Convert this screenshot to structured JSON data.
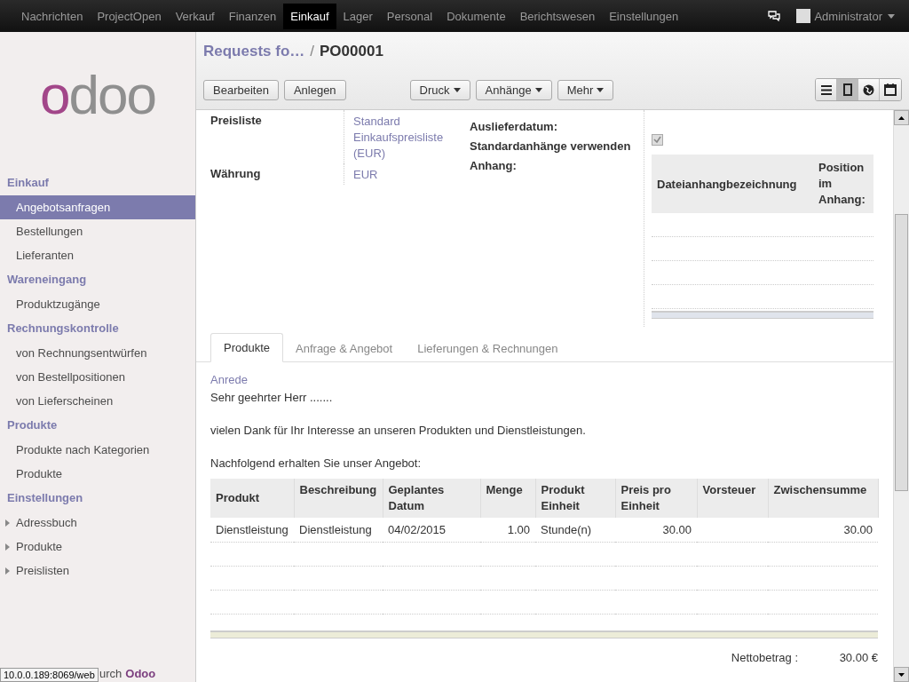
{
  "top_menu": [
    {
      "label": "Nachrichten",
      "selected": false
    },
    {
      "label": "ProjectOpen",
      "selected": false
    },
    {
      "label": "Verkauf",
      "selected": false
    },
    {
      "label": "Finanzen",
      "selected": false
    },
    {
      "label": "Einkauf",
      "selected": true
    },
    {
      "label": "Lager",
      "selected": false
    },
    {
      "label": "Personal",
      "selected": false
    },
    {
      "label": "Dokumente",
      "selected": false
    },
    {
      "label": "Berichtswesen",
      "selected": false
    },
    {
      "label": "Einstellungen",
      "selected": false
    }
  ],
  "user": {
    "name": "Administrator"
  },
  "logo": "odoo",
  "sidebar": [
    {
      "title": "Einkauf",
      "items": [
        {
          "label": "Angebotsanfragen",
          "selected": true,
          "kind": "link"
        },
        {
          "label": "Bestellungen",
          "selected": false,
          "kind": "link"
        },
        {
          "label": "Lieferanten",
          "selected": false,
          "kind": "link"
        }
      ]
    },
    {
      "title": "Wareneingang",
      "items": [
        {
          "label": "Produktzugänge",
          "selected": false,
          "kind": "link"
        }
      ]
    },
    {
      "title": "Rechnungskontrolle",
      "items": [
        {
          "label": "von Rechnungsentwürfen",
          "selected": false,
          "kind": "link"
        },
        {
          "label": "von Bestellpositionen",
          "selected": false,
          "kind": "link"
        },
        {
          "label": "von Lieferscheinen",
          "selected": false,
          "kind": "link"
        }
      ]
    },
    {
      "title": "Produkte",
      "items": [
        {
          "label": "Produkte nach Kategorien",
          "selected": false,
          "kind": "link"
        },
        {
          "label": "Produkte",
          "selected": false,
          "kind": "link"
        }
      ]
    },
    {
      "title": "Einstellungen",
      "items": [
        {
          "label": "Adressbuch",
          "selected": false,
          "kind": "folder"
        },
        {
          "label": "Produkte",
          "selected": false,
          "kind": "folder"
        },
        {
          "label": "Preislisten",
          "selected": false,
          "kind": "folder"
        }
      ]
    }
  ],
  "sidebar_footer": {
    "text": "urch",
    "brand": "Odoo"
  },
  "status_url": "10.0.0.189:8069/web",
  "breadcrumb": {
    "parent": "Requests fo…",
    "separator": "/",
    "current": "PO00001"
  },
  "buttons": [
    "Bearbeiten",
    "Anlegen"
  ],
  "dropdowns": [
    "Druck",
    "Anhänge",
    "Mehr"
  ],
  "views": [
    {
      "kind": "list",
      "selected": false
    },
    {
      "kind": "form",
      "selected": true
    },
    {
      "kind": "map",
      "selected": false
    },
    {
      "kind": "calendar",
      "selected": false
    }
  ],
  "form_left": [
    {
      "label": "Preisliste",
      "value": "Standard Einkaufspreisliste (EUR)"
    },
    {
      "label": "Währung",
      "value": "EUR"
    }
  ],
  "form_right": {
    "delivery_label": "Auslieferdatum:",
    "default_attachments": {
      "label": "Standardanhänge verwenden",
      "checked": true
    },
    "attachment_label": "Anhang:",
    "attachment_columns": [
      "Dateianhangbezeichnung",
      "Position im Anhang:"
    ]
  },
  "tabs": [
    {
      "label": "Produkte",
      "selected": true
    },
    {
      "label": "Anfrage & Angebot",
      "selected": false
    },
    {
      "label": "Lieferungen & Rechnungen",
      "selected": false
    }
  ],
  "salutation_label": "Anrede",
  "letter": [
    "Sehr geehrter Herr .......",
    "vielen Dank für Ihr Interesse an unseren Produkten und Dienstleistungen.",
    "Nachfolgend erhalten Sie unser Angebot:"
  ],
  "products": {
    "columns": [
      {
        "label": "Produkt",
        "numeric": false
      },
      {
        "label": "Beschreibung",
        "numeric": false
      },
      {
        "label": "Geplantes Datum",
        "numeric": false
      },
      {
        "label": "Menge",
        "numeric": true
      },
      {
        "label": "Produkt Einheit",
        "numeric": false
      },
      {
        "label": "Preis pro Einheit",
        "numeric": true
      },
      {
        "label": "Vorsteuer"
      },
      {
        "label": "Zwischensumme",
        "numeric": true
      }
    ],
    "rows": [
      [
        "Dienstleistung",
        "Dienstleistung",
        "04/02/2015",
        "1.00",
        "Stunde(n)",
        "30.00",
        "",
        "30.00"
      ]
    ]
  },
  "totals": [
    {
      "label": "Nettobetrag :",
      "value": "30.00 €"
    }
  ]
}
